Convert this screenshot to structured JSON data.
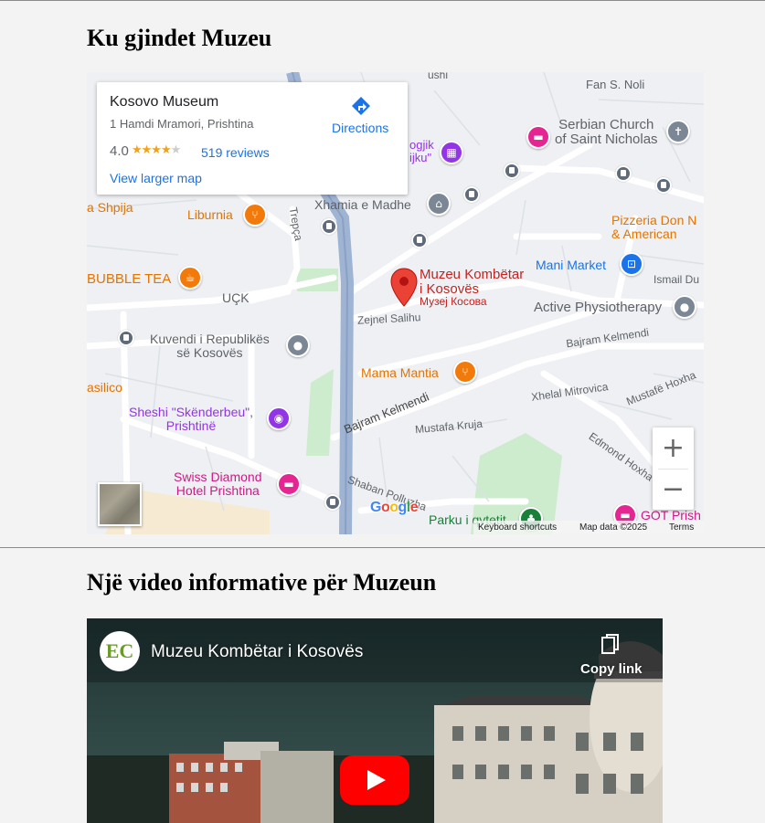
{
  "map_section": {
    "title": "Ku gjindet Muzeu"
  },
  "map": {
    "card": {
      "name": "Kosovo Museum",
      "address": "1 Hamdi Mramori, Prishtina",
      "rating": "4.0",
      "stars_filled": 4,
      "reviews": "519 reviews",
      "view_larger": "View larger map",
      "directions": "Directions"
    },
    "labels": {
      "fan_noli": "Fan S. Noli",
      "serbian_church": "Serbian Church\nof Saint Nicholas",
      "pedagogik": "ogjik\nijku\"",
      "xhamia": "Xhamia e Madhe",
      "shpija": "a Shpija",
      "liburnia": "Liburnia",
      "trepca": "Trepça",
      "pizzeria": "Pizzeria Don N\n& American",
      "mani_market": "Mani Market",
      "bubble_tea": "BUBBLE TEA",
      "uck": "UÇK",
      "museum_name": "Muzeu Kombëtar\ni Kosovës",
      "museum_cyr": "Музеј Косова",
      "ismail": "Ismail Du",
      "active_physio": "Active Physiotherapy",
      "zejnel": "Zejnel Salihu",
      "kuvendi": "Kuvendi i Republikës\nsë Kosovës",
      "bajram1": "Bajram Kelmendi",
      "mama_mantia": "Mama Mantia",
      "basilico": "asilico",
      "xhelal": "Xhelal Mitrovica",
      "mustafe_hoxha": "Mustafë Hoxha",
      "skenderbeu": "Sheshi \"Skënderbeu\",\nPrishtinë",
      "bajram2": "Bajram Kelmendi",
      "mustafa_kruja": "Mustafa Kruja",
      "edmond": "Edmond Hoxha",
      "swiss": "Swiss Diamond\nHotel Prishtina",
      "shaban": "Shaban Polluzha",
      "parku": "Parku i qytetit",
      "got": "GOT Prish",
      "ushi": "ushi"
    },
    "zoom_in": "+",
    "zoom_out": "−",
    "google": "Google",
    "footer": {
      "shortcuts": "Keyboard shortcuts",
      "data": "Map data ©2025",
      "terms": "Terms"
    },
    "colors": {
      "road": "#ffffff",
      "main_road": "#8ea4c8",
      "park": "#cdeccd",
      "background": "#eef0f3"
    }
  },
  "video_section": {
    "title": "Një video informative për Muzeun"
  },
  "video": {
    "title": "Muzeu Kombëtar i Kosovës",
    "channel_logo": "EC",
    "copy_link": "Copy link",
    "play_color": "#ff0000"
  }
}
